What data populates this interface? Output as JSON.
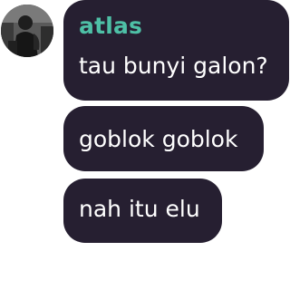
{
  "chat": {
    "sender": {
      "name": "atlas",
      "name_color": "#4ec0a6",
      "avatar_icon": "user-photo-avatar"
    },
    "bubble_color": "#261f31",
    "messages": [
      {
        "text": "tau bunyi galon?"
      },
      {
        "text": "goblok goblok"
      },
      {
        "text": "nah itu elu"
      }
    ]
  }
}
